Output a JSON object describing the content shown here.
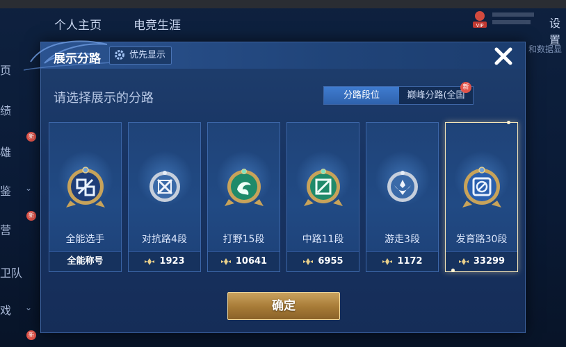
{
  "background": {
    "tabs": [
      "个人主页",
      "电竞生涯"
    ],
    "settings": "设置",
    "left_items": [
      "页",
      "绩",
      "雄",
      "鉴",
      "营",
      "卫队",
      "戏"
    ],
    "new_badge": "新",
    "vip": "VIP",
    "right_text": "和数据显"
  },
  "modal": {
    "title": "展示分路",
    "priority_label": "优先显示",
    "subtitle": "请选择展示的分路",
    "segment": {
      "active": "分路段位",
      "inactive": "巅峰分路(全国",
      "new_badge": "新"
    },
    "cards": [
      {
        "name": "全能选手",
        "bottom": "全能称号",
        "show_icon": false,
        "badge": "allround"
      },
      {
        "name": "对抗路4段",
        "bottom": "1923",
        "show_icon": true,
        "badge": "clash"
      },
      {
        "name": "打野15段",
        "bottom": "10641",
        "show_icon": true,
        "badge": "jungle"
      },
      {
        "name": "中路11段",
        "bottom": "6955",
        "show_icon": true,
        "badge": "mid"
      },
      {
        "name": "游走3段",
        "bottom": "1172",
        "show_icon": true,
        "badge": "roam"
      },
      {
        "name": "发育路30段",
        "bottom": "33299",
        "show_icon": true,
        "badge": "farm",
        "selected": true
      }
    ],
    "confirm": "确定"
  },
  "colors": {
    "accent_gold": "#c9a25e",
    "selected_border": "#f5e6b8",
    "active_tab": "#3f7cd0"
  }
}
